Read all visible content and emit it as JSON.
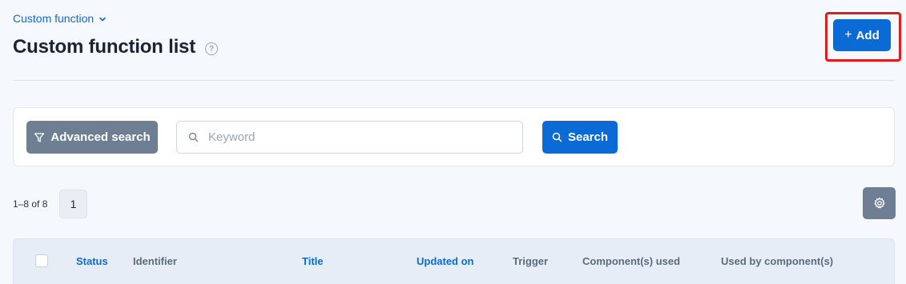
{
  "breadcrumb": {
    "label": "Custom function"
  },
  "page": {
    "title": "Custom function list",
    "help": "?"
  },
  "toolbar": {
    "add_label": "Add",
    "add_icon": "+"
  },
  "search": {
    "advanced_label": "Advanced search",
    "keyword_placeholder": "Keyword",
    "keyword_value": "",
    "search_label": "Search"
  },
  "pagination": {
    "range": "1–8 of 8",
    "current_page": "1"
  },
  "table": {
    "columns": [
      {
        "label": "Status",
        "sortable": true
      },
      {
        "label": "Identifier",
        "sortable": false
      },
      {
        "label": "Title",
        "sortable": true
      },
      {
        "label": "Updated on",
        "sortable": true
      },
      {
        "label": "Trigger",
        "sortable": false
      },
      {
        "label": "Component(s) used",
        "sortable": false
      },
      {
        "label": "Used by component(s)",
        "sortable": false
      }
    ]
  },
  "colors": {
    "primary": "#0b6bd6",
    "secondary_button": "#6f7f93",
    "highlight": "#e21b1b",
    "background": "#f5f8fc"
  },
  "icons": [
    "chevron-down-icon",
    "help-icon",
    "plus-icon",
    "filter-icon",
    "search-icon",
    "gear-icon"
  ]
}
